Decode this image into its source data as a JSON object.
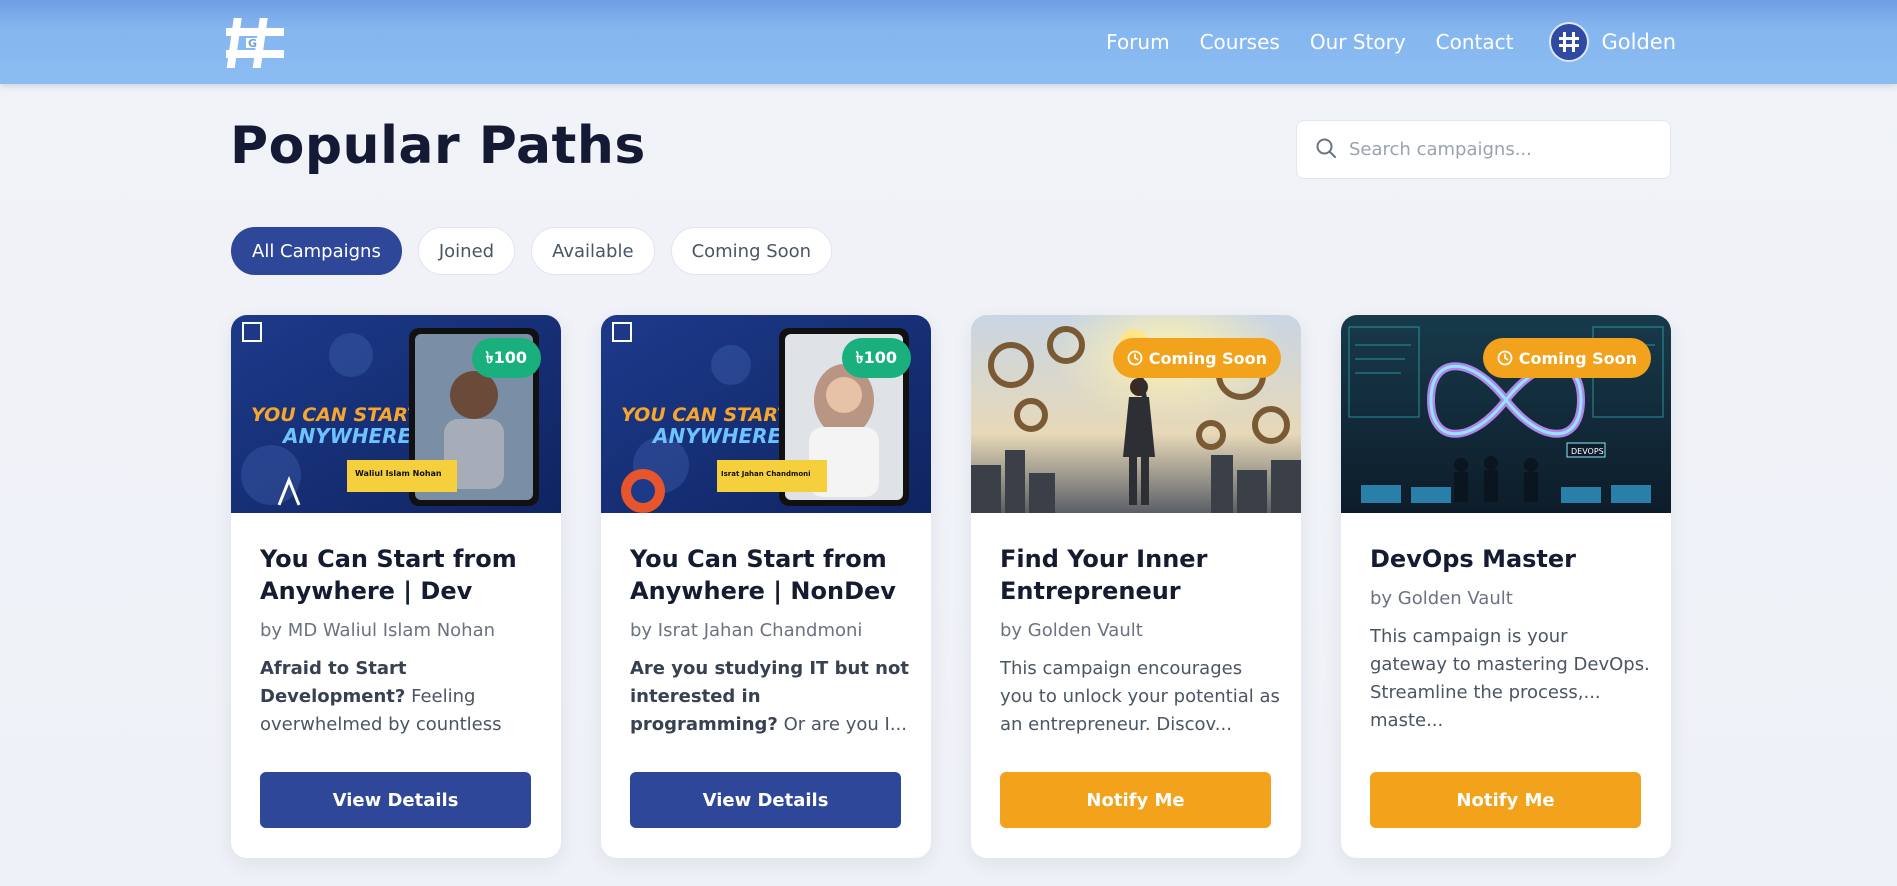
{
  "header": {
    "nav": [
      {
        "label": "Forum"
      },
      {
        "label": "Courses"
      },
      {
        "label": "Our Story"
      },
      {
        "label": "Contact"
      }
    ],
    "profile_name": "Golden"
  },
  "page": {
    "title": "Popular Paths",
    "search_placeholder": "Search campaigns..."
  },
  "filters": [
    {
      "label": "All Campaigns",
      "active": true
    },
    {
      "label": "Joined",
      "active": false
    },
    {
      "label": "Available",
      "active": false
    },
    {
      "label": "Coming Soon",
      "active": false
    }
  ],
  "cards": [
    {
      "title": "You Can Start from Anywhere | Dev",
      "author": "by MD Waliul Islam Nohan",
      "desc_bold": "Afraid to Start Development?",
      "desc": "Feeling overwhelmed by countless video...",
      "badge": "৳100",
      "button": "View Details",
      "thumb_text_1": "YOU CAN START",
      "thumb_text_2": "ANYWHERE",
      "thumb_caption": "Waliul Islam Nohan"
    },
    {
      "title": "You Can Start from Anywhere | NonDev",
      "author": "by Israt Jahan Chandmoni",
      "desc_bold": "Are you studying IT but not interested in programming?",
      "desc": "Or are you I...",
      "badge": "৳100",
      "button": "View Details",
      "thumb_text_1": "YOU CAN START",
      "thumb_text_2": "ANYWHERE",
      "thumb_caption": "Israt Jahan Chandmoni"
    },
    {
      "title": "Find Your Inner Entrepreneur",
      "author": "by Golden Vault",
      "desc": "This campaign encourages you to unlock your potential as an entrepreneur. Discov...",
      "badge": "Coming Soon",
      "button": "Notify Me"
    },
    {
      "title": "DevOps Master",
      "author": "by Golden Vault",
      "desc": "This campaign is your gateway to mastering DevOps. Streamline the process,... maste...",
      "badge": "Coming Soon",
      "button": "Notify Me",
      "thumb_label": "DEVOPS"
    }
  ],
  "colors": {
    "header": "#86b6f0",
    "primary": "#2e4799",
    "price_badge": "#19b07d",
    "accent": "#f2a21b"
  },
  "icons": {
    "logo": "golden-vault-logo",
    "search": "search-icon",
    "clock": "clock-icon"
  }
}
